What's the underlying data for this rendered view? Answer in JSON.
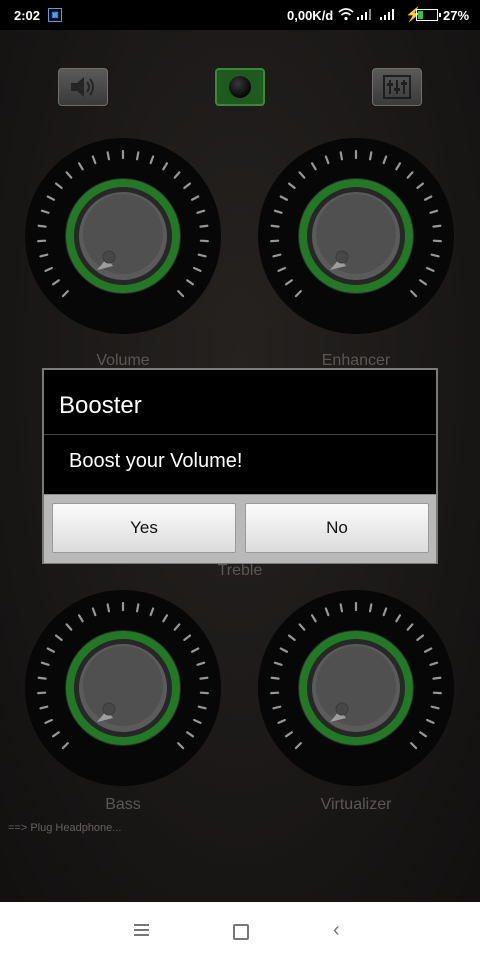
{
  "status_bar": {
    "time": "2:02",
    "app_icon": "image-icon",
    "network_speed": "0,00K/d",
    "battery_percent": "27%",
    "battery_level": 0.27
  },
  "toolbar": {
    "speaker_icon": "speaker-icon",
    "power_icon": "power-icon",
    "equalizer_icon": "equalizer-icon",
    "power_color": "#2f8b2f"
  },
  "knobs": {
    "volume": "Volume",
    "enhancer": "Enhancer",
    "treble": "Treble",
    "bass": "Bass",
    "virtualizer": "Virtualizer"
  },
  "hint": "==> Plug Headphone...",
  "dialog": {
    "title": "Booster",
    "message": "Boost your Volume!",
    "yes": "Yes",
    "no": "No"
  },
  "nav": {
    "menu_icon": "menu-icon",
    "home_icon": "home-icon",
    "back_icon": "back-icon"
  },
  "colors": {
    "accent_green": "#35b93a"
  }
}
